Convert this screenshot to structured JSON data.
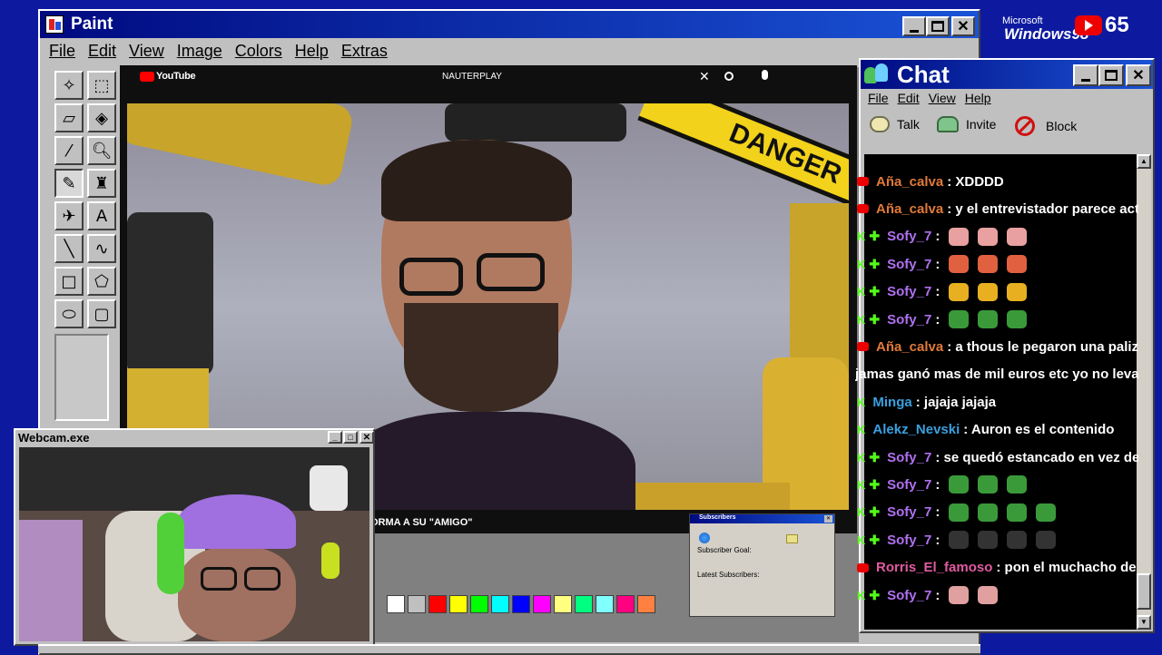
{
  "desktop": {
    "logo_brand": "Microsoft",
    "logo_product": "Windows98",
    "counter": "65"
  },
  "paint": {
    "title": "Paint",
    "menu": [
      "File",
      "Edit",
      "View",
      "Image",
      "Colors",
      "Help",
      "Extras"
    ],
    "tools": [
      "free-select-icon",
      "rect-select-icon",
      "eraser-icon",
      "fill-bucket-icon",
      "color-picker-icon",
      "magnifier-icon",
      "pencil-icon",
      "brush-icon",
      "airbrush-icon",
      "text-icon",
      "line-icon",
      "curve-icon",
      "rectangle-icon",
      "polygon-icon",
      "ellipse-icon",
      "rounded-rect-icon"
    ],
    "palette": [
      "#ffffff",
      "#c0c0c0",
      "#ff0000",
      "#ffff00",
      "#00ff00",
      "#00ffff",
      "#0000ff",
      "#ff00ff",
      "#ffff80",
      "#00ff80",
      "#80ffff",
      "#ff0080",
      "#ff8040"
    ]
  },
  "youtube": {
    "brand": "YouTube",
    "search_text": "NAUTERPLAY",
    "banner": "DANGER",
    "ticker": "ORMA A SU \"AMIGO\""
  },
  "webcam": {
    "title": "Webcam.exe"
  },
  "subscribers": {
    "title": "Subscribers",
    "goal_label": "Subscriber Goal:",
    "latest_label": "Latest Subscribers:"
  },
  "chat": {
    "title": "Chat",
    "menu": [
      "File",
      "Edit",
      "View",
      "Help"
    ],
    "toolbar": {
      "talk": "Talk",
      "invite": "Invite",
      "block": "Block"
    },
    "messages": [
      {
        "badge": "yt",
        "user": "Aña_calva",
        "color": "#e07a3a",
        "text": ": XDDDD",
        "emotes": []
      },
      {
        "badge": "yt",
        "user": "Aña_calva",
        "color": "#e07a3a",
        "text": ": y el entrevistador parece actor",
        "emotes": []
      },
      {
        "badge": "kick",
        "user": "Sofy_7",
        "color": "#b070f0",
        "text": ":",
        "emotes": [
          "#e8a0a0",
          "#e8a0a0",
          "#e8a0a0"
        ]
      },
      {
        "badge": "kick",
        "user": "Sofy_7",
        "color": "#b070f0",
        "text": ":",
        "emotes": [
          "#e06040",
          "#e06040",
          "#e06040"
        ]
      },
      {
        "badge": "kick",
        "user": "Sofy_7",
        "color": "#b070f0",
        "text": ":",
        "emotes": [
          "#e8b020",
          "#e8b020",
          "#e8b020"
        ]
      },
      {
        "badge": "kick",
        "user": "Sofy_7",
        "color": "#b070f0",
        "text": ":",
        "emotes": [
          "#3a9a3a",
          "#3a9a3a",
          "#3a9a3a"
        ]
      },
      {
        "badge": "yt",
        "user": "Aña_calva",
        "color": "#e07a3a",
        "text": ": a thous le pegaron una paliza c",
        "emotes": []
      },
      {
        "badge": "none",
        "user": "",
        "color": "#ffffff",
        "text": "jamas ganó mas de mil euros etc yo no levant",
        "emotes": []
      },
      {
        "badge": "kick",
        "user": "Minga",
        "color": "#3aa0e0",
        "text": ": jajaja jajaja",
        "emotes": []
      },
      {
        "badge": "kick",
        "user": "Alekz_Nevski",
        "color": "#3aa0e0",
        "text": ": Auron es el contenido",
        "emotes": []
      },
      {
        "badge": "kick",
        "user": "Sofy_7",
        "color": "#b070f0",
        "text": ": se quedó estancado en vez de ir",
        "emotes": []
      },
      {
        "badge": "kick",
        "user": "Sofy_7",
        "color": "#b070f0",
        "text": ":",
        "emotes": [
          "#3a9a3a",
          "#3a9a3a",
          "#3a9a3a"
        ]
      },
      {
        "badge": "kick",
        "user": "Sofy_7",
        "color": "#b070f0",
        "text": ":",
        "emotes": [
          "#3a9a3a",
          "#3a9a3a",
          "#3a9a3a",
          "#3a9a3a"
        ]
      },
      {
        "badge": "kick",
        "user": "Sofy_7",
        "color": "#b070f0",
        "text": ":",
        "emotes": [
          "#333333",
          "#333333",
          "#333333",
          "#333333"
        ]
      },
      {
        "badge": "yt",
        "user": "Rorris_El_famoso",
        "color": "#e05aa0",
        "text": ": pon el muchacho de los",
        "emotes": []
      },
      {
        "badge": "kick",
        "user": "Sofy_7",
        "color": "#b070f0",
        "text": ":",
        "emotes": [
          "#e0a0a0",
          "#e0a0a0"
        ]
      }
    ]
  }
}
